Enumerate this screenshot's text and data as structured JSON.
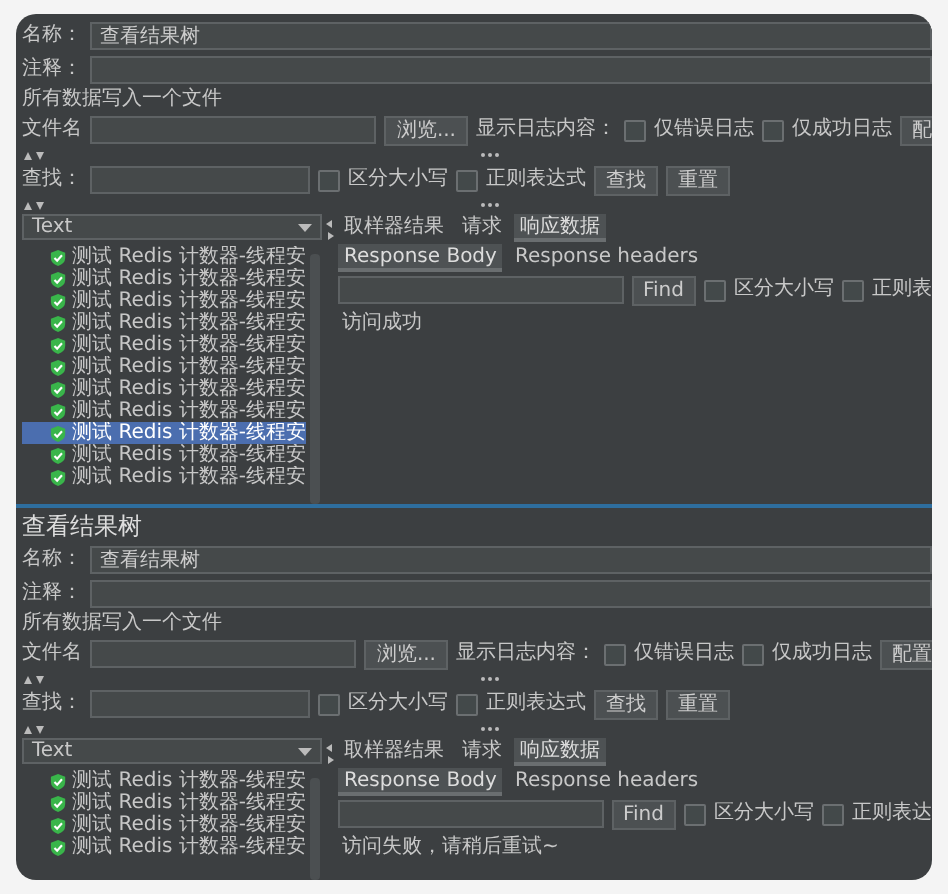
{
  "panels": [
    {
      "name_label": "名称：",
      "name_value": "查看结果树",
      "comment_label": "注释：",
      "file_section": "所有数据写入一个文件",
      "file_label": "文件名",
      "browse_button": "浏览...",
      "log_label": "显示日志内容：",
      "log_options": [
        {
          "label": "仅错误日志",
          "checked": false
        },
        {
          "label": "仅成功日志",
          "checked": false
        }
      ],
      "config_button": "配",
      "search_label": "查找：",
      "search_options": [
        {
          "label": "区分大小写",
          "checked": false
        },
        {
          "label": "正则表达式",
          "checked": false
        }
      ],
      "search_button": "查找",
      "reset_button": "重置",
      "renderer": "Text",
      "tabs": [
        {
          "label": "取样器结果",
          "selected": false
        },
        {
          "label": "请求",
          "selected": false
        },
        {
          "label": "响应数据",
          "selected": true
        }
      ],
      "body_tabs": [
        {
          "label": "Response Body",
          "selected": true
        },
        {
          "label": "Response headers",
          "selected": false
        }
      ],
      "find_button": "Find",
      "find_options": [
        {
          "label": "区分大小写",
          "checked": false
        },
        {
          "label": "正则表",
          "checked": false
        }
      ],
      "response": "访问成功",
      "results": [
        {
          "label": "测试 Redis 计数器-线程安",
          "selected": false
        },
        {
          "label": "测试 Redis 计数器-线程安",
          "selected": false
        },
        {
          "label": "测试 Redis 计数器-线程安",
          "selected": false
        },
        {
          "label": "测试 Redis 计数器-线程安",
          "selected": false
        },
        {
          "label": "测试 Redis 计数器-线程安",
          "selected": false
        },
        {
          "label": "测试 Redis 计数器-线程安",
          "selected": false
        },
        {
          "label": "测试 Redis 计数器-线程安",
          "selected": false
        },
        {
          "label": "测试 Redis 计数器-线程安",
          "selected": false
        },
        {
          "label": "测试 Redis 计数器-线程安",
          "selected": true
        },
        {
          "label": "测试 Redis 计数器-线程安",
          "selected": false
        },
        {
          "label": "测试 Redis 计数器-线程安",
          "selected": false
        }
      ]
    },
    {
      "title": "查看结果树",
      "name_label": "名称：",
      "name_value": "查看结果树",
      "comment_label": "注释：",
      "file_section": "所有数据写入一个文件",
      "file_label": "文件名",
      "browse_button": "浏览...",
      "log_label": "显示日志内容：",
      "log_options": [
        {
          "label": "仅错误日志",
          "checked": false
        },
        {
          "label": "仅成功日志",
          "checked": false
        }
      ],
      "config_button": "配置",
      "search_label": "查找：",
      "search_options": [
        {
          "label": "区分大小写",
          "checked": false
        },
        {
          "label": "正则表达式",
          "checked": false
        }
      ],
      "search_button": "查找",
      "reset_button": "重置",
      "renderer": "Text",
      "tabs": [
        {
          "label": "取样器结果",
          "selected": false
        },
        {
          "label": "请求",
          "selected": false
        },
        {
          "label": "响应数据",
          "selected": true
        }
      ],
      "body_tabs": [
        {
          "label": "Response Body",
          "selected": true
        },
        {
          "label": "Response headers",
          "selected": false
        }
      ],
      "find_button": "Find",
      "find_options": [
        {
          "label": "区分大小写",
          "checked": false
        },
        {
          "label": "正则表达",
          "checked": false
        }
      ],
      "response": "访问失败，请稍后重试~",
      "results": [
        {
          "label": "测试 Redis 计数器-线程安",
          "selected": false
        },
        {
          "label": "测试 Redis 计数器-线程安",
          "selected": false
        },
        {
          "label": "测试 Redis 计数器-线程安",
          "selected": false
        },
        {
          "label": "测试 Redis 计数器-线程安",
          "selected": false
        }
      ]
    }
  ]
}
